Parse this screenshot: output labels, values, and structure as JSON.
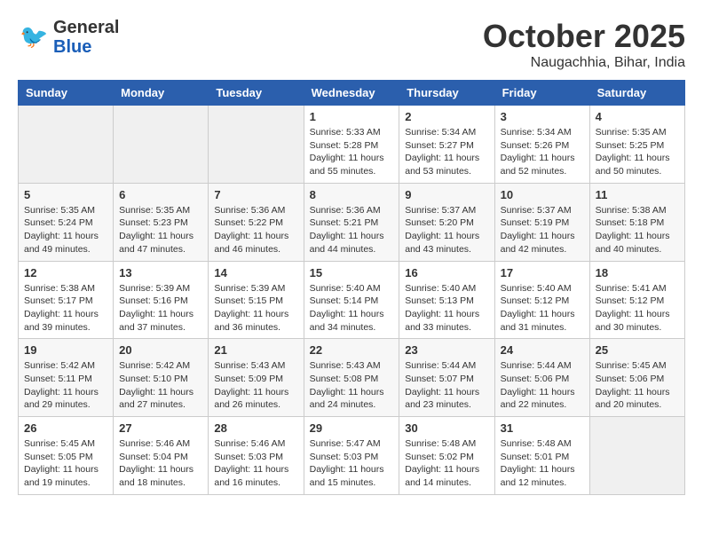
{
  "header": {
    "logo_general": "General",
    "logo_blue": "Blue",
    "month": "October 2025",
    "location": "Naugachhia, Bihar, India"
  },
  "weekdays": [
    "Sunday",
    "Monday",
    "Tuesday",
    "Wednesday",
    "Thursday",
    "Friday",
    "Saturday"
  ],
  "weeks": [
    [
      {
        "day": "",
        "info": ""
      },
      {
        "day": "",
        "info": ""
      },
      {
        "day": "",
        "info": ""
      },
      {
        "day": "1",
        "info": "Sunrise: 5:33 AM\nSunset: 5:28 PM\nDaylight: 11 hours\nand 55 minutes."
      },
      {
        "day": "2",
        "info": "Sunrise: 5:34 AM\nSunset: 5:27 PM\nDaylight: 11 hours\nand 53 minutes."
      },
      {
        "day": "3",
        "info": "Sunrise: 5:34 AM\nSunset: 5:26 PM\nDaylight: 11 hours\nand 52 minutes."
      },
      {
        "day": "4",
        "info": "Sunrise: 5:35 AM\nSunset: 5:25 PM\nDaylight: 11 hours\nand 50 minutes."
      }
    ],
    [
      {
        "day": "5",
        "info": "Sunrise: 5:35 AM\nSunset: 5:24 PM\nDaylight: 11 hours\nand 49 minutes."
      },
      {
        "day": "6",
        "info": "Sunrise: 5:35 AM\nSunset: 5:23 PM\nDaylight: 11 hours\nand 47 minutes."
      },
      {
        "day": "7",
        "info": "Sunrise: 5:36 AM\nSunset: 5:22 PM\nDaylight: 11 hours\nand 46 minutes."
      },
      {
        "day": "8",
        "info": "Sunrise: 5:36 AM\nSunset: 5:21 PM\nDaylight: 11 hours\nand 44 minutes."
      },
      {
        "day": "9",
        "info": "Sunrise: 5:37 AM\nSunset: 5:20 PM\nDaylight: 11 hours\nand 43 minutes."
      },
      {
        "day": "10",
        "info": "Sunrise: 5:37 AM\nSunset: 5:19 PM\nDaylight: 11 hours\nand 42 minutes."
      },
      {
        "day": "11",
        "info": "Sunrise: 5:38 AM\nSunset: 5:18 PM\nDaylight: 11 hours\nand 40 minutes."
      }
    ],
    [
      {
        "day": "12",
        "info": "Sunrise: 5:38 AM\nSunset: 5:17 PM\nDaylight: 11 hours\nand 39 minutes."
      },
      {
        "day": "13",
        "info": "Sunrise: 5:39 AM\nSunset: 5:16 PM\nDaylight: 11 hours\nand 37 minutes."
      },
      {
        "day": "14",
        "info": "Sunrise: 5:39 AM\nSunset: 5:15 PM\nDaylight: 11 hours\nand 36 minutes."
      },
      {
        "day": "15",
        "info": "Sunrise: 5:40 AM\nSunset: 5:14 PM\nDaylight: 11 hours\nand 34 minutes."
      },
      {
        "day": "16",
        "info": "Sunrise: 5:40 AM\nSunset: 5:13 PM\nDaylight: 11 hours\nand 33 minutes."
      },
      {
        "day": "17",
        "info": "Sunrise: 5:40 AM\nSunset: 5:12 PM\nDaylight: 11 hours\nand 31 minutes."
      },
      {
        "day": "18",
        "info": "Sunrise: 5:41 AM\nSunset: 5:12 PM\nDaylight: 11 hours\nand 30 minutes."
      }
    ],
    [
      {
        "day": "19",
        "info": "Sunrise: 5:42 AM\nSunset: 5:11 PM\nDaylight: 11 hours\nand 29 minutes."
      },
      {
        "day": "20",
        "info": "Sunrise: 5:42 AM\nSunset: 5:10 PM\nDaylight: 11 hours\nand 27 minutes."
      },
      {
        "day": "21",
        "info": "Sunrise: 5:43 AM\nSunset: 5:09 PM\nDaylight: 11 hours\nand 26 minutes."
      },
      {
        "day": "22",
        "info": "Sunrise: 5:43 AM\nSunset: 5:08 PM\nDaylight: 11 hours\nand 24 minutes."
      },
      {
        "day": "23",
        "info": "Sunrise: 5:44 AM\nSunset: 5:07 PM\nDaylight: 11 hours\nand 23 minutes."
      },
      {
        "day": "24",
        "info": "Sunrise: 5:44 AM\nSunset: 5:06 PM\nDaylight: 11 hours\nand 22 minutes."
      },
      {
        "day": "25",
        "info": "Sunrise: 5:45 AM\nSunset: 5:06 PM\nDaylight: 11 hours\nand 20 minutes."
      }
    ],
    [
      {
        "day": "26",
        "info": "Sunrise: 5:45 AM\nSunset: 5:05 PM\nDaylight: 11 hours\nand 19 minutes."
      },
      {
        "day": "27",
        "info": "Sunrise: 5:46 AM\nSunset: 5:04 PM\nDaylight: 11 hours\nand 18 minutes."
      },
      {
        "day": "28",
        "info": "Sunrise: 5:46 AM\nSunset: 5:03 PM\nDaylight: 11 hours\nand 16 minutes."
      },
      {
        "day": "29",
        "info": "Sunrise: 5:47 AM\nSunset: 5:03 PM\nDaylight: 11 hours\nand 15 minutes."
      },
      {
        "day": "30",
        "info": "Sunrise: 5:48 AM\nSunset: 5:02 PM\nDaylight: 11 hours\nand 14 minutes."
      },
      {
        "day": "31",
        "info": "Sunrise: 5:48 AM\nSunset: 5:01 PM\nDaylight: 11 hours\nand 12 minutes."
      },
      {
        "day": "",
        "info": ""
      }
    ]
  ]
}
